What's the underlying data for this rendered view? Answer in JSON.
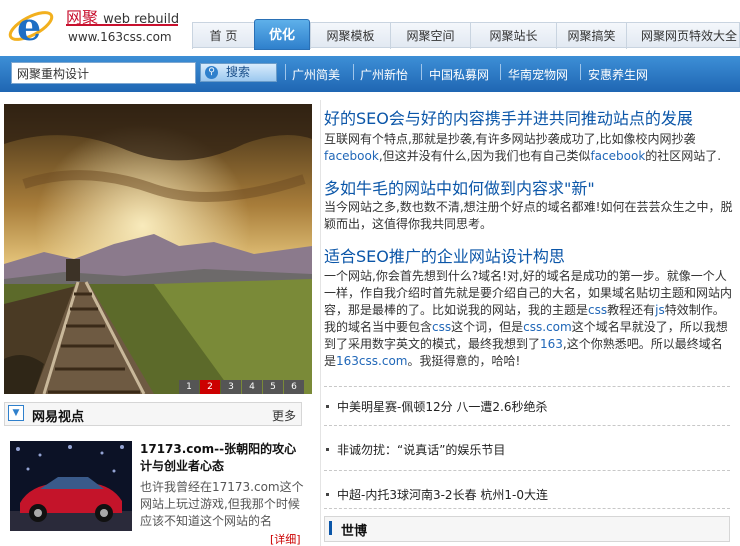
{
  "brand": {
    "name": "网聚",
    "sub": "web rebuild",
    "domain": "www.163css.com"
  },
  "nav": {
    "items": [
      "首 页",
      "优化",
      "网聚模板",
      "网聚空间",
      "网聚站长",
      "网聚搞笑",
      "网聚网页特效大全"
    ],
    "active": 1
  },
  "search": {
    "value": "网聚重构设计",
    "button": "搜索"
  },
  "quick_links": [
    "广州简美",
    "广州新怡",
    "中国私募网",
    "华南宠物网",
    "安惠养生网"
  ],
  "slider": {
    "dots": [
      "1",
      "2",
      "3",
      "4",
      "5",
      "6"
    ],
    "active": 1
  },
  "articles": [
    {
      "title": "好的SEO会与好的内容携手并进共同推动站点的发展",
      "body": "互联网有个特点,那就是抄袭,有许多网站抄袭成功了,比如像校内网抄袭facebook,但这并没有什么,因为我们也有自己类似facebook的社区网站了."
    },
    {
      "title": "多如牛毛的网站中如何做到内容求\"新\"",
      "body": "当今网站之多,数也数不清,想注册个好点的域名都难!如何在芸芸众生之中，脱颖而出，这值得你我共同思考。"
    },
    {
      "title": "适合SEO推广的企业网站设计构思",
      "body": "一个网站,你会首先想到什么?域名!对,好的域名是成功的第一步。就像一个人一样，作自我介绍时首先就是要介绍自己的大名，如果域名贴切主题和网站内容，那是最棒的了。比如说我的网站，我的主题是css教程还有js特效制作。我的域名当中要包含css这个词，但是css.com这个域名早就没了，所以我想到了采用数字英文的模式，最终我想到了163,这个你熟悉吧。所以最终域名是163css.com。我挺得意的，哈哈!"
    }
  ],
  "news": [
    "中美明星赛-佩顿12分 八一遭2.6秒绝杀",
    "非诚勿扰：“说真话”的娱乐节目",
    "中超-内托3球河南3-2长春 杭州1-0大连"
  ],
  "viewpoint": {
    "title": "网易视点",
    "more": "更多",
    "headline": "17173.com--张朝阳的攻心计与创业者心态",
    "body": "也许我曾经在17173.com这个网站上玩过游戏,但我那个时候应该不知道这个网站的名",
    "detail": "[详细]"
  },
  "section2": {
    "title": "世博"
  },
  "colors": {
    "brand_red": "#c8102e",
    "nav_blue": "#1f66b3",
    "link_blue": "#0b56a8",
    "detail_red": "#cc0000"
  }
}
